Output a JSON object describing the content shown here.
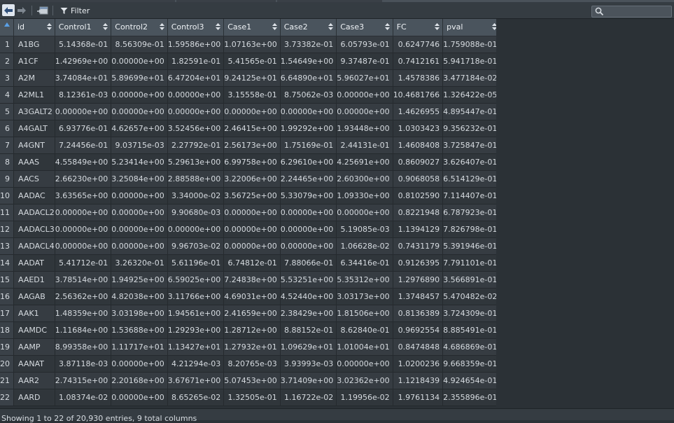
{
  "toolbar": {
    "back_icon": "arrow-left-icon",
    "forward_icon": "arrow-right-icon",
    "popout_icon": "popout-window-icon",
    "filter_label": "Filter",
    "search_placeholder": ""
  },
  "table": {
    "columns": [
      "id",
      "Control1",
      "Control2",
      "Control3",
      "Case1",
      "Case2",
      "Case3",
      "FC",
      "pval"
    ],
    "rows": [
      {
        "n": "1",
        "cells": [
          "A1BG",
          "5.14368e-01",
          "8.56309e-01",
          "1.59586e+00",
          "1.07163e+00",
          "3.73382e-01",
          "6.05793e-01",
          "0.6247746",
          "1.759088e-01"
        ]
      },
      {
        "n": "2",
        "cells": [
          "A1CF",
          "1.42969e+00",
          "0.00000e+00",
          "1.82591e-01",
          "5.41565e-01",
          "1.54649e+00",
          "9.37487e-01",
          "0.7412161",
          "5.941718e-01"
        ]
      },
      {
        "n": "3",
        "cells": [
          "A2M",
          "3.74084e+01",
          "5.89699e+01",
          "6.47204e+01",
          "9.24125e+01",
          "6.64890e+01",
          "5.96027e+01",
          "1.4578386",
          "3.477184e-02"
        ]
      },
      {
        "n": "4",
        "cells": [
          "A2ML1",
          "8.12361e-03",
          "0.00000e+00",
          "0.00000e+00",
          "3.15558e-01",
          "8.75062e-03",
          "0.00000e+00",
          "10.4681766",
          "1.326422e-05"
        ]
      },
      {
        "n": "5",
        "cells": [
          "A3GALT2",
          "0.00000e+00",
          "0.00000e+00",
          "0.00000e+00",
          "0.00000e+00",
          "0.00000e+00",
          "0.00000e+00",
          "1.4626955",
          "4.895447e-01"
        ]
      },
      {
        "n": "6",
        "cells": [
          "A4GALT",
          "6.93776e-01",
          "4.62657e+00",
          "3.52456e+00",
          "2.46415e+00",
          "1.99292e+00",
          "1.93448e+00",
          "1.0303423",
          "9.356232e-01"
        ]
      },
      {
        "n": "7",
        "cells": [
          "A4GNT",
          "7.24456e-01",
          "9.03715e-03",
          "2.27792e-01",
          "2.56173e+00",
          "1.75169e-01",
          "2.44131e-01",
          "1.4608408",
          "3.725847e-01"
        ]
      },
      {
        "n": "8",
        "cells": [
          "AAAS",
          "4.55849e+00",
          "5.23414e+00",
          "5.29613e+00",
          "6.99758e+00",
          "6.29610e+00",
          "4.25691e+00",
          "0.8609027",
          "3.626407e-01"
        ]
      },
      {
        "n": "9",
        "cells": [
          "AACS",
          "2.66230e+00",
          "3.25084e+00",
          "2.88588e+00",
          "3.22006e+00",
          "2.24465e+00",
          "2.60300e+00",
          "0.9068058",
          "6.514129e-01"
        ]
      },
      {
        "n": "10",
        "cells": [
          "AADAC",
          "3.63565e+00",
          "0.00000e+00",
          "3.34000e-02",
          "3.56725e+00",
          "5.33079e+00",
          "1.09330e+00",
          "0.8102590",
          "7.114407e-01"
        ]
      },
      {
        "n": "11",
        "cells": [
          "AADACL2",
          "0.00000e+00",
          "0.00000e+00",
          "9.90680e-03",
          "0.00000e+00",
          "0.00000e+00",
          "0.00000e+00",
          "0.8221948",
          "6.787923e-01"
        ]
      },
      {
        "n": "12",
        "cells": [
          "AADACL3",
          "0.00000e+00",
          "0.00000e+00",
          "0.00000e+00",
          "0.00000e+00",
          "0.00000e+00",
          "5.19085e-03",
          "1.1394129",
          "7.826798e-01"
        ]
      },
      {
        "n": "13",
        "cells": [
          "AADACL4",
          "0.00000e+00",
          "0.00000e+00",
          "9.96703e-02",
          "0.00000e+00",
          "0.00000e+00",
          "1.06628e-02",
          "0.7431179",
          "5.391946e-01"
        ]
      },
      {
        "n": "14",
        "cells": [
          "AADAT",
          "5.41712e-01",
          "3.26320e-01",
          "5.61196e-01",
          "6.74812e-01",
          "7.88066e-01",
          "6.34416e-01",
          "0.9126395",
          "7.791101e-01"
        ]
      },
      {
        "n": "15",
        "cells": [
          "AAED1",
          "3.78514e+00",
          "1.94925e+00",
          "6.59025e+00",
          "7.24838e+00",
          "5.53251e+00",
          "5.35312e+00",
          "1.2976890",
          "3.566891e-01"
        ]
      },
      {
        "n": "16",
        "cells": [
          "AAGAB",
          "2.56362e+00",
          "4.82038e+00",
          "3.11766e+00",
          "4.69031e+00",
          "4.52440e+00",
          "3.03173e+00",
          "1.3748457",
          "5.470482e-02"
        ]
      },
      {
        "n": "17",
        "cells": [
          "AAK1",
          "1.48359e+00",
          "3.03198e+00",
          "1.94561e+00",
          "2.41659e+00",
          "2.38429e+00",
          "1.81506e+00",
          "0.8136389",
          "3.724309e-01"
        ]
      },
      {
        "n": "18",
        "cells": [
          "AAMDC",
          "1.11684e+00",
          "1.53688e+00",
          "1.29293e+00",
          "1.28712e+00",
          "8.88152e-01",
          "8.62840e-01",
          "0.9692554",
          "8.885491e-01"
        ]
      },
      {
        "n": "19",
        "cells": [
          "AAMP",
          "8.99358e+00",
          "1.11717e+01",
          "1.13427e+01",
          "1.27932e+01",
          "1.09629e+01",
          "1.01004e+01",
          "0.8474848",
          "4.686869e-01"
        ]
      },
      {
        "n": "20",
        "cells": [
          "AANAT",
          "3.87118e-03",
          "0.00000e+00",
          "4.21294e-03",
          "8.20765e-03",
          "3.93993e-03",
          "0.00000e+00",
          "1.0200236",
          "9.668359e-01"
        ]
      },
      {
        "n": "21",
        "cells": [
          "AAR2",
          "2.74315e+00",
          "2.20168e+00",
          "3.67671e+00",
          "5.07453e+00",
          "3.71409e+00",
          "3.02362e+00",
          "1.1218439",
          "4.924654e-01"
        ]
      },
      {
        "n": "22",
        "cells": [
          "AARD",
          "1.08374e-02",
          "0.00000e+00",
          "8.65265e-02",
          "1.32505e-01",
          "1.16722e-02",
          "1.19956e-02",
          "1.9761134",
          "2.355896e-01"
        ]
      }
    ]
  },
  "status": {
    "text": "Showing 1 to 22 of 20,930 entries, 9 total columns"
  },
  "colors": {
    "header_bg": "#4a545d",
    "row_odd": "#363c42",
    "row_even": "#30363b",
    "sort_active": "#5aa0e6"
  }
}
